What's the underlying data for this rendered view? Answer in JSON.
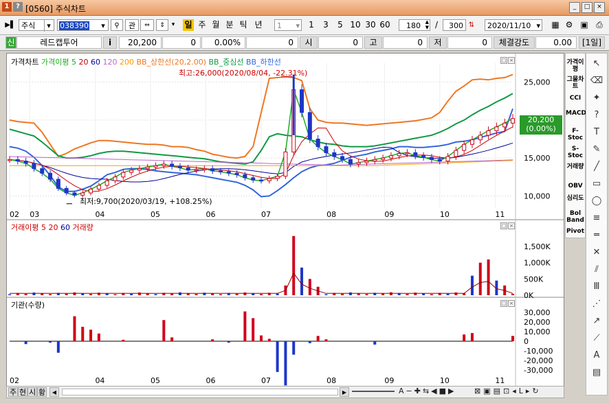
{
  "window": {
    "number": "1",
    "help": "?",
    "title": "[0560] 주식차트",
    "controls": [
      "_",
      "□",
      "×"
    ]
  },
  "toolbar": {
    "market": "주식",
    "code": "038390",
    "search_btn": "🔍",
    "link_label": "관",
    "periods": [
      "일",
      "주",
      "월",
      "분",
      "틱",
      "년"
    ],
    "active_period": "일",
    "interval_value": "1",
    "quick_intervals": [
      "1",
      "3",
      "5",
      "10",
      "30",
      "60"
    ],
    "count": "180",
    "total": "300",
    "date": "2020/11/10"
  },
  "info": {
    "badge": "신",
    "name": "레드캡투어",
    "info_btn": "i",
    "price": "20,200",
    "change": "0",
    "rate": "0.00%",
    "volume": "0",
    "open_label": "시",
    "open": "0",
    "high_label": "고",
    "high": "0",
    "low_label": "저",
    "low": "0",
    "strength_label": "체결강도",
    "strength": "0.00",
    "unit": "[1일]"
  },
  "price_panel": {
    "legend": [
      {
        "text": "가격차트",
        "color": "#000000"
      },
      {
        "text": "가격이평 5",
        "color": "#22aa22"
      },
      {
        "text": "20",
        "color": "#cc0000"
      },
      {
        "text": "60",
        "color": "#000099"
      },
      {
        "text": "120",
        "color": "#bb66cc"
      },
      {
        "text": "200",
        "color": "#ff9900"
      },
      {
        "text": "BB_상한선(20,2.00)",
        "color": "#ee7722"
      },
      {
        "text": "BB_중심선",
        "color": "#119944"
      },
      {
        "text": "BB_하한선",
        "color": "#3366dd"
      }
    ],
    "y_ticks": [
      "25,000",
      "20,000",
      "15,000",
      "10,000"
    ],
    "high_annotation": "최고:26,000(2020/08/04, -22.31%)",
    "low_annotation": "최저:9,700(2020/03/19, +108.25%)",
    "last_price": "20,200",
    "last_rate": "(0.00%)"
  },
  "volume_panel": {
    "legend": [
      {
        "text": "거래이평 5",
        "color": "#cc0000"
      },
      {
        "text": "20",
        "color": "#cc0000"
      },
      {
        "text": "60",
        "color": "#000099"
      },
      {
        "text": "거래량",
        "color": "#cc0000"
      }
    ],
    "y_ticks": [
      "1,500K",
      "1,000K",
      "500K",
      "0K"
    ]
  },
  "inst_panel": {
    "legend": [
      {
        "text": "기관(수량)",
        "color": "#000000"
      }
    ],
    "y_ticks": [
      "30,000",
      "20,000",
      "10,000",
      "0",
      "-10,000",
      "-20,000",
      "-30,000"
    ]
  },
  "x_axis": {
    "price_labels": [
      "02",
      "03",
      "04",
      "05",
      "06",
      "07",
      "08",
      "09",
      "10",
      "11"
    ],
    "bottom_labels": [
      "02",
      "04",
      "05",
      "06",
      "07",
      "08",
      "09",
      "10",
      "11"
    ]
  },
  "right_toolbar": [
    "가격이평",
    "그물차트",
    "CCI",
    "MACD",
    "F-Stoc",
    "S-Stoc",
    "거래량",
    "OBV",
    "심리도",
    "Bol Band",
    "Pivot"
  ],
  "right_icons": [
    "cursor-icon",
    "eraser-icon",
    "all-icon",
    "help-icon",
    "text-icon",
    "pen-icon",
    "line-icon",
    "rect-icon",
    "circle-icon",
    "fib-icon",
    "hline-icon",
    "gann-icon",
    "channel-icon",
    "cycle-icon",
    "fan-icon",
    "arrow-icon",
    "zigzag-icon",
    "auto-icon",
    "settings-icon"
  ],
  "bottom_tabs": [
    "주",
    "현",
    "시",
    "황"
  ],
  "chart_data": {
    "type": "candlestick",
    "ylim": [
      8500,
      27500
    ],
    "annotations": [
      {
        "label": "최고",
        "value": 26000,
        "date": "2020/08/04"
      },
      {
        "label": "최저",
        "value": 9700,
        "date": "2020/03/19"
      }
    ],
    "price_path": [
      14800,
      14600,
      14300,
      13600,
      13000,
      12200,
      11000,
      10400,
      10100,
      10400,
      10900,
      11400,
      12000,
      12500,
      13100,
      13400,
      13600,
      13800,
      14000,
      14200,
      13900,
      13700,
      13400,
      13500,
      13600,
      13300,
      13200,
      13000,
      12800,
      12400,
      12100,
      12000,
      12300,
      12600,
      15800,
      24000,
      21000,
      17500,
      16500,
      15700,
      15200,
      14800,
      14200,
      14400,
      14600,
      14800,
      15000,
      15300,
      15600,
      15700,
      15300,
      15100,
      14800,
      14600,
      15200,
      16000,
      16800,
      17400,
      18000,
      18600,
      19100,
      19600,
      20200
    ],
    "bb_upper": [
      20000,
      19800,
      19700,
      19600,
      18400,
      16800,
      15200,
      15600,
      16200,
      16600,
      17000,
      17300,
      17300,
      17200,
      17100,
      17000,
      16900,
      16800,
      16800,
      16700,
      16500,
      16500,
      16400,
      16100,
      15900,
      15500,
      15300,
      15100,
      15000,
      15200,
      16500,
      21000,
      25500,
      25600,
      25700,
      25600,
      25200,
      21500,
      20000,
      19700,
      19600,
      19600,
      19500,
      19400,
      19300,
      19400,
      19500,
      19600,
      19700,
      19800,
      19900,
      20100,
      20300,
      21000,
      22500,
      23800,
      24500,
      25300,
      25400,
      25300,
      25500,
      25600,
      26000
    ],
    "bb_mid": [
      18800,
      18500,
      18200,
      17900,
      17100,
      16200,
      15300,
      15000,
      15000,
      15100,
      15300,
      15600,
      15800,
      15900,
      15900,
      15800,
      15700,
      15600,
      15500,
      15400,
      15300,
      15200,
      15100,
      15000,
      14900,
      14700,
      14500,
      14400,
      14300,
      14200,
      14500,
      16000,
      17800,
      18200,
      18000,
      17900,
      17800,
      17400,
      17100,
      16900,
      16800,
      16600,
      16500,
      16500,
      16500,
      16600,
      16800,
      17000,
      17200,
      17400,
      17600,
      17800,
      18000,
      18400,
      18900,
      19500,
      20000,
      20700,
      21300,
      21800,
      22400,
      22900,
      23500
    ],
    "bb_lower": [
      16500,
      16300,
      15900,
      15100,
      14000,
      12700,
      11200,
      10600,
      10600,
      10900,
      11300,
      12000,
      12800,
      13100,
      13500,
      13600,
      13600,
      13500,
      13300,
      13200,
      13100,
      13000,
      12900,
      12800,
      12600,
      12400,
      12200,
      12000,
      11800,
      11400,
      10800,
      9900,
      10000,
      10700,
      11500,
      12400,
      13200,
      13700,
      14000,
      14100,
      14300,
      14700,
      15100,
      15300,
      15500,
      15800,
      16000,
      16200,
      16500,
      16500,
      16400,
      16400,
      16500,
      16600,
      16800,
      17100,
      17200,
      17400,
      17700,
      18000,
      18300,
      18500,
      21500
    ],
    "volume_ylim": [
      0,
      1900000
    ],
    "inst_ylim": [
      -35000,
      35000
    ]
  }
}
